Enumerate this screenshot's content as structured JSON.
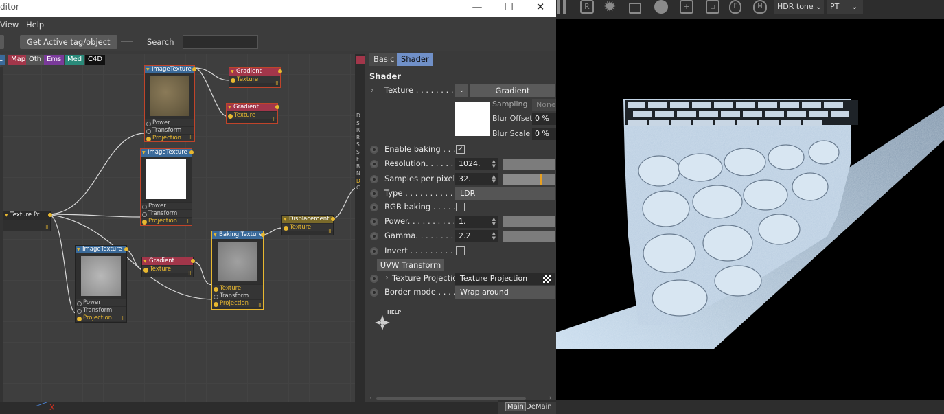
{
  "window": {
    "title": "ditor",
    "minimize": "—",
    "maximize": "☐",
    "close": "✕"
  },
  "menu": [
    "View",
    "Help"
  ],
  "toolbar": {
    "get_active_label": "Get Active tag/object",
    "search_label": "Search",
    "search_value": ""
  },
  "categories": [
    {
      "label": "L",
      "color": "#3a6a9a"
    },
    {
      "label": "Map",
      "color": "#a2364a"
    },
    {
      "label": "Oth",
      "color": "#555555"
    },
    {
      "label": "Ems",
      "color": "#7a3a9a"
    },
    {
      "label": "Med",
      "color": "#2a8a7a"
    },
    {
      "label": "C4D",
      "color": "#111111"
    }
  ],
  "nodes": {
    "image_texture_1": {
      "title": "ImageTexture",
      "ports": [
        "Power",
        "Transform",
        "Projection"
      ]
    },
    "gradient_1": {
      "title": "Gradient",
      "port": "Texture"
    },
    "gradient_2": {
      "title": "Gradient",
      "port": "Texture"
    },
    "image_texture_2": {
      "title": "ImageTexture",
      "ports": [
        "Power",
        "Transform",
        "Projection"
      ]
    },
    "texture_projection": {
      "title": "Texture Pr"
    },
    "image_texture_3": {
      "title": "ImageTexture",
      "ports": [
        "Power",
        "Transform",
        "Projection"
      ]
    },
    "gradient_3": {
      "title": "Gradient",
      "port": "Texture"
    },
    "baking_texture": {
      "title": "Baking Texture",
      "ports": [
        "Texture",
        "Transform",
        "Projection"
      ]
    },
    "displacement": {
      "title": "Displacement",
      "port": "Texture"
    }
  },
  "edge_letters": [
    "D",
    "S",
    "R",
    "R",
    "S",
    "S",
    "F",
    "B",
    "N",
    "D",
    "C"
  ],
  "props": {
    "tabs": [
      "Basic",
      "Shader"
    ],
    "section": "Shader",
    "texture": {
      "label": "Texture . . . . . . . . .",
      "value": "Gradient"
    },
    "sampling": {
      "label": "Sampling",
      "value": "None"
    },
    "blur_offset": {
      "label": "Blur Offset",
      "value": "0 %"
    },
    "blur_scale": {
      "label": "Blur Scale",
      "value": "0 %"
    },
    "enable_baking": {
      "label": "Enable baking . . . .",
      "checked": "✓"
    },
    "resolution": {
      "label": "Resolution. . . . . . .",
      "value": "1024."
    },
    "samples": {
      "label": "Samples per pixel . .",
      "value": "32."
    },
    "samples_fill": 0.75,
    "type": {
      "label": "Type . . . . . . . . . . .",
      "value": "LDR"
    },
    "rgb_baking": {
      "label": "RGB baking . . . . . ."
    },
    "power": {
      "label": "Power. . . . . . . . . .",
      "value": "1."
    },
    "gamma": {
      "label": "Gamma. . . . . . . . .",
      "value": "2.2"
    },
    "invert": {
      "label": "Invert . . . . . . . . . ."
    },
    "uvw_button": "UVW Transform",
    "texture_projection": {
      "label": "Texture Projection",
      "value": "Texture Projection"
    },
    "border_mode": {
      "label": "Border mode . . . . .",
      "value": "Wrap around"
    },
    "help_label": "HELP"
  },
  "viewport": {
    "icon_r": "R",
    "hdr_tone": "HDR tone",
    "pt": "PT",
    "tabs": [
      "Main",
      "DeMain"
    ]
  },
  "axis_x": "X"
}
